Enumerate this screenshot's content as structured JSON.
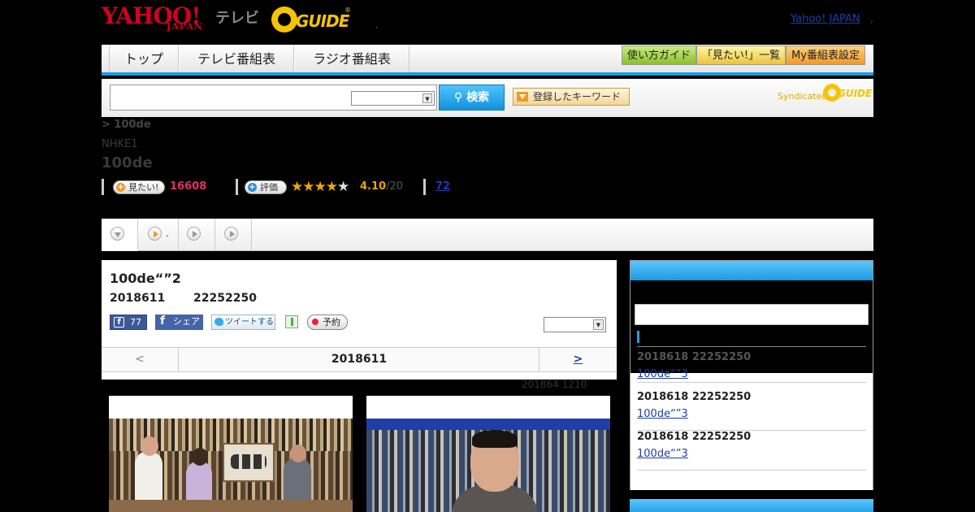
{
  "header": {
    "logo_yahoo": "YAHOO!",
    "logo_japan": "JAPAN",
    "logo_tv": "テレビ",
    "logo_gguide": "GUIDE",
    "logo_gguide_reg": "®",
    "separator": ",",
    "yahoo_japan_link": "Yahoo! JAPAN",
    "yahoo_japan_sep": ","
  },
  "nav": {
    "tabs": [
      "トップ",
      "テレビ番組表",
      "ラジオ番組表"
    ],
    "buttons": [
      "使い方ガイド",
      "「見たい!」一覧",
      "My番組表設定"
    ]
  },
  "search": {
    "input_value": "",
    "select_value": "",
    "search_button": "検索",
    "keyword_button": "登録したキーワード",
    "syndicated": "Syndicated",
    "syndicated_logo": "GUIDE"
  },
  "program": {
    "breadcrumb": "> 100de",
    "channel": "NHKE1",
    "title": "100de",
    "want_label": "見たい!",
    "want_count": "16608",
    "rate_label": "評価",
    "rating": "4.10",
    "rating_max": "/20",
    "stars_filled": 4,
    "stars_total": 5,
    "reviews": "72"
  },
  "tabs": [
    {
      "label": "",
      "active": true
    },
    {
      "label": ".",
      "active": false
    },
    {
      "label": "",
      "active": false
    },
    {
      "label": "",
      "active": false
    }
  ],
  "episode": {
    "title": "100de“”2",
    "date": "2018611",
    "time": "22252250",
    "fb_count": "77",
    "fb_share": "シェア",
    "tweet": "ツイートする",
    "reserve": "予約",
    "select_value": "",
    "prev": "<",
    "current": "2018611",
    "next": ">",
    "updated": "201864  1210"
  },
  "sidebar": {
    "items": [
      {
        "date": "2018618  22252250",
        "link": "100de“”3"
      },
      {
        "date": "2018618  22252250",
        "link": "100de“”3"
      },
      {
        "date": "2018618  22252250",
        "link": "100de“”3"
      }
    ]
  },
  "colors": {
    "accent_blue": "#1b9be0",
    "want_pink": "#e0306f",
    "rating_orange": "#e8a400",
    "link_blue": "#1c3fa8",
    "yahoo_red": "#d1001f"
  }
}
